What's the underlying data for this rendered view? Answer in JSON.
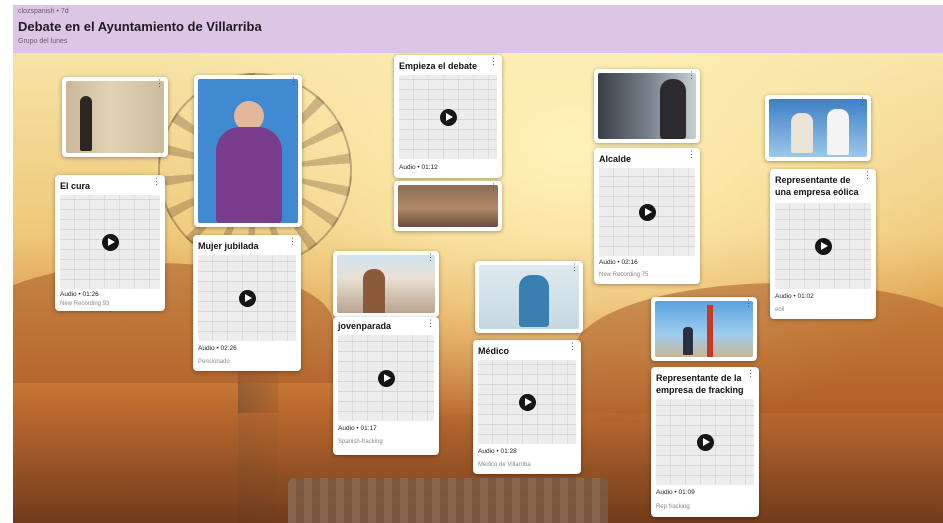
{
  "header": {
    "breadcrumb": "clozspanish • 7d",
    "title": "Debate en el Ayuntamiento de Villarriba",
    "subtitle": "Grupo del lunes",
    "bg": "#dcc6e6"
  },
  "kebab": "⋮",
  "cards": {
    "cura": {
      "title": "El cura",
      "duration": "Audio • 01:26",
      "recording": "New Recording 93"
    },
    "jubilada": {
      "title": "Mujer jubilada",
      "duration": "Audio • 02:26",
      "recording": "Pensionado"
    },
    "debate": {
      "title": "Empieza el debate",
      "duration": "Audio • 01:12"
    },
    "joven": {
      "title": "jovenparada",
      "duration": "Audio • 01:17",
      "recording": "Spanish-fracking"
    },
    "medico": {
      "title": "Médico",
      "duration": "Audio • 01:28",
      "recording": "Médico de Villarriba"
    },
    "alcalde": {
      "title": "Alcalde",
      "duration": "Audio • 02:16",
      "recording": "New Recording 75"
    },
    "fracking": {
      "title": "Representante de la empresa de fracking",
      "duration": "Audio • 01:09",
      "recording": "Rep fracking"
    },
    "eolica": {
      "title": "Representante de una empresa eólica",
      "duration": "Audio • 01:02",
      "recording": "eoli"
    }
  }
}
